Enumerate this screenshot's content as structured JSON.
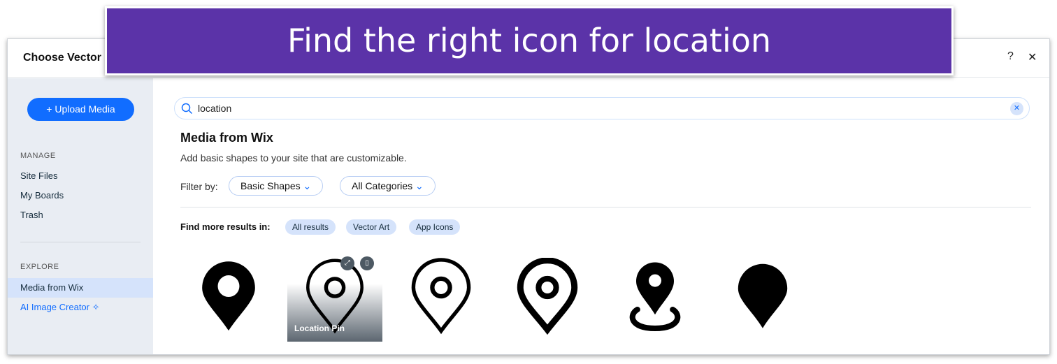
{
  "banner": "Find the right icon for location",
  "dialog": {
    "title": "Choose Vector",
    "help": "?",
    "close": "✕"
  },
  "sidebar": {
    "upload": "+ Upload Media",
    "manage": "MANAGE",
    "manage_items": [
      "Site Files",
      "My Boards",
      "Trash"
    ],
    "explore": "EXPLORE",
    "explore_items": [
      "Media from Wix",
      "AI Image Creator"
    ],
    "ai_icon": "✧"
  },
  "search": {
    "value": "location",
    "clear": "✕"
  },
  "main": {
    "heading": "Media from Wix",
    "description": "Add basic shapes to your site that are customizable.",
    "filter_label": "Filter by:",
    "filters": [
      "Basic Shapes",
      "All Categories"
    ],
    "more_label": "Find more results in:",
    "chips": [
      "All results",
      "Vector Art",
      "App Icons"
    ],
    "hover_label": "Location Pin"
  },
  "colors": {
    "accent": "#116dff",
    "banner": "#5b33a8",
    "sidebar": "#e9edf3"
  }
}
